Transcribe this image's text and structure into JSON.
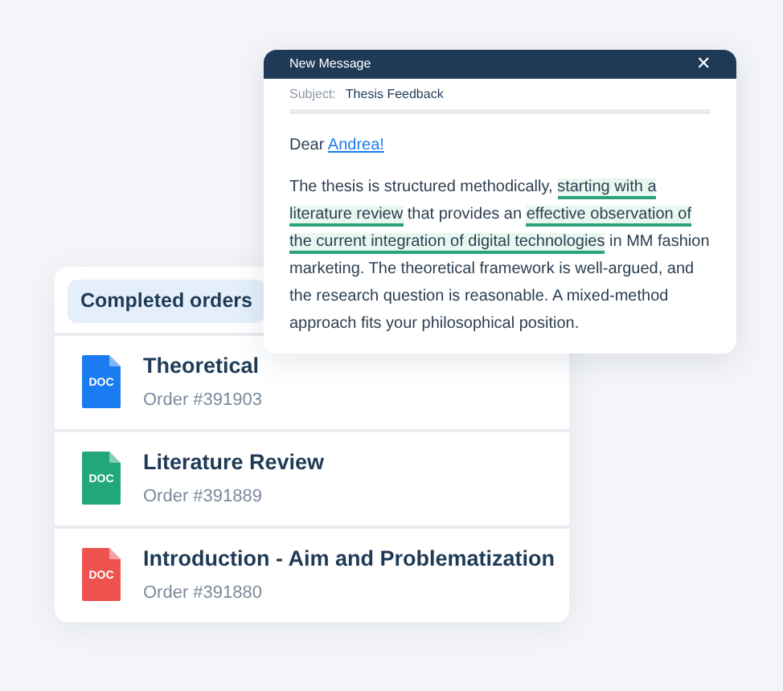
{
  "orders_card": {
    "heading": "Completed orders",
    "orders": [
      {
        "title": "Theoretical",
        "number": "Order #391903",
        "file_label": "DOC",
        "color": "#1a7cf0"
      },
      {
        "title": "Literature Review",
        "number": "Order #391889",
        "file_label": "DOC",
        "color": "#23a87a"
      },
      {
        "title": "Introduction - Aim and Problematization",
        "number": "Order #391880",
        "file_label": "DOC",
        "color": "#ef5350"
      }
    ]
  },
  "message": {
    "title": "New Message",
    "close": "✕",
    "subject_label": "Subject:",
    "subject": "Thesis Feedback",
    "greeting": "Dear ",
    "recipient": "Andrea!",
    "body": [
      {
        "text": "The thesis is structured methodically, ",
        "highlighted": false
      },
      {
        "text": "starting with a literature review",
        "highlighted": true
      },
      {
        "text": " that provides an ",
        "highlighted": false
      },
      {
        "text": "effective observation of the current integration of digital technologies",
        "highlighted": true
      },
      {
        "text": " in MM fashion marketing. The theoretical framework is well-argued, and the research question is reasonable. A mixed-method approach fits your philosophical position.",
        "highlighted": false
      }
    ]
  }
}
